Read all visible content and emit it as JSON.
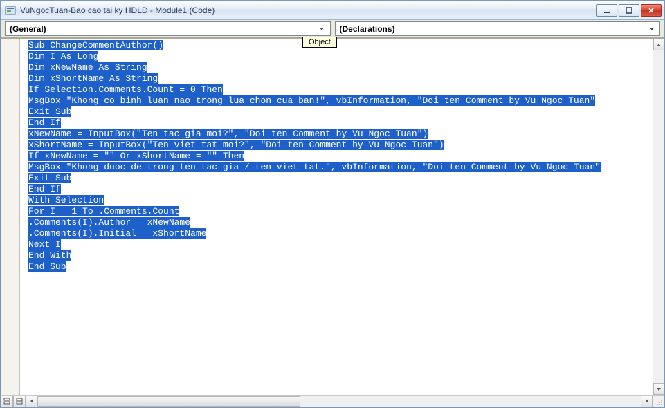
{
  "title": "VuNgocTuan-Bao cao tai ky HDLD - Module1 (Code)",
  "dropdowns": {
    "left": "(General)",
    "right": "(Declarations)"
  },
  "tooltip": "Object",
  "code_lines": [
    "Sub ChangeCommentAuthor()",
    "Dim I As Long",
    "Dim xNewName As String",
    "Dim xShortName As String",
    "If Selection.Comments.Count = 0 Then",
    "MsgBox \"Khong co binh luan nao trong lua chon cua ban!\", vbInformation, \"Doi ten Comment by Vu Ngoc Tuan\"",
    "Exit Sub",
    "End If",
    "xNewName = InputBox(\"Ten tac gia moi?\", \"Doi ten Comment by Vu Ngoc Tuan\")",
    "xShortName = InputBox(\"Ten viet tat moi?\", \"Doi ten Comment by Vu Ngoc Tuan\")",
    "If xNewName = \"\" Or xShortName = \"\" Then",
    "MsgBox \"Khong duoc de trong ten tac gia / ten viet tat.\", vbInformation, \"Doi ten Comment by Vu Ngoc Tuan\"",
    "Exit Sub",
    "End If",
    "With Selection",
    "For I = 1 To .Comments.Count",
    ".Comments(I).Author = xNewName",
    ".Comments(I).Initial = xShortName",
    "Next I",
    "End With",
    "End Sub"
  ]
}
